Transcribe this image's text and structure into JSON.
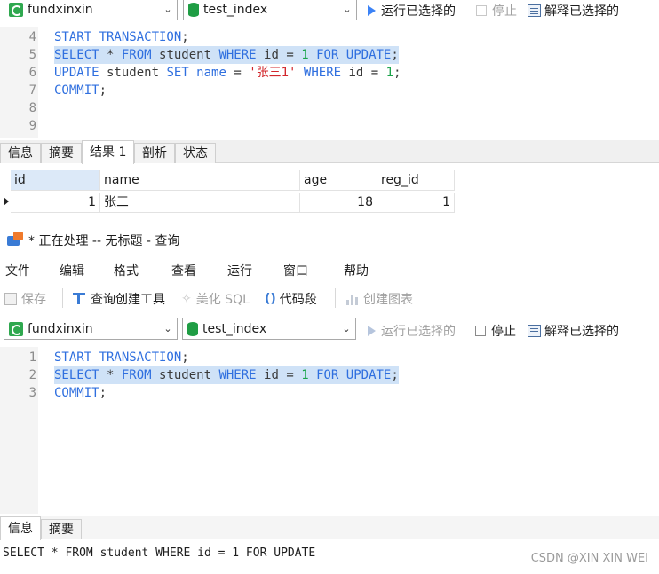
{
  "top_window": {
    "connection_select": "fundxinxin",
    "database_select": "test_index",
    "run_selected_label": "运行已选择的",
    "stop_label": "停止",
    "explain_selected_label": "解释已选择的",
    "editor_lines": [
      {
        "num": "4",
        "tokens": [
          {
            "t": "START TRANSACTION",
            "c": "kw"
          },
          {
            "t": ";",
            "c": "plain"
          }
        ],
        "highlight": false
      },
      {
        "num": "5",
        "tokens": [
          {
            "t": "SELECT",
            "c": "kw"
          },
          {
            "t": " * ",
            "c": "plain"
          },
          {
            "t": "FROM",
            "c": "kw"
          },
          {
            "t": " student ",
            "c": "plain"
          },
          {
            "t": "WHERE",
            "c": "kw"
          },
          {
            "t": " id = ",
            "c": "plain"
          },
          {
            "t": "1",
            "c": "num"
          },
          {
            "t": " ",
            "c": "plain"
          },
          {
            "t": "FOR UPDATE",
            "c": "kw"
          },
          {
            "t": ";",
            "c": "plain"
          }
        ],
        "highlight": true
      },
      {
        "num": "6",
        "tokens": [
          {
            "t": "UPDATE",
            "c": "kw"
          },
          {
            "t": " student ",
            "c": "plain"
          },
          {
            "t": "SET",
            "c": "kw"
          },
          {
            "t": " ",
            "c": "plain"
          },
          {
            "t": "name",
            "c": "kw"
          },
          {
            "t": " = ",
            "c": "plain"
          },
          {
            "t": "'张三1'",
            "c": "str"
          },
          {
            "t": " ",
            "c": "plain"
          },
          {
            "t": "WHERE",
            "c": "kw"
          },
          {
            "t": " id = ",
            "c": "plain"
          },
          {
            "t": "1",
            "c": "num"
          },
          {
            "t": ";",
            "c": "plain"
          }
        ],
        "highlight": false
      },
      {
        "num": "7",
        "tokens": [
          {
            "t": "COMMIT",
            "c": "kw"
          },
          {
            "t": ";",
            "c": "plain"
          }
        ],
        "highlight": false
      },
      {
        "num": "8",
        "tokens": [],
        "highlight": false
      },
      {
        "num": "9",
        "tokens": [],
        "highlight": false
      }
    ],
    "tabs": [
      "信息",
      "摘要",
      "结果 1",
      "剖析",
      "状态"
    ],
    "active_tab": "结果 1",
    "result_columns": [
      "id",
      "name",
      "age",
      "reg_id"
    ],
    "result_rows": [
      [
        "1",
        "张三",
        "18",
        "1"
      ]
    ]
  },
  "bottom_window": {
    "title": "* 正在处理 -- 无标题 - 查询",
    "menu": [
      "文件",
      "编辑",
      "格式",
      "查看",
      "运行",
      "窗口",
      "帮助"
    ],
    "toolbar": {
      "save": "保存",
      "query_builder": "查询创建工具",
      "beautify": "美化 SQL",
      "code_snippet": "代码段",
      "create_chart": "创建图表"
    },
    "connection_select": "fundxinxin",
    "database_select": "test_index",
    "run_selected_label": "运行已选择的",
    "stop_label": "停止",
    "explain_selected_label": "解释已选择的",
    "editor_lines": [
      {
        "num": "1",
        "tokens": [
          {
            "t": "START TRANSACTION",
            "c": "kw"
          },
          {
            "t": ";",
            "c": "plain"
          }
        ],
        "highlight": false
      },
      {
        "num": "2",
        "tokens": [
          {
            "t": "SELECT",
            "c": "kw"
          },
          {
            "t": " * ",
            "c": "plain"
          },
          {
            "t": "FROM",
            "c": "kw"
          },
          {
            "t": " student ",
            "c": "plain"
          },
          {
            "t": "WHERE",
            "c": "kw"
          },
          {
            "t": " id = ",
            "c": "plain"
          },
          {
            "t": "1",
            "c": "num"
          },
          {
            "t": " ",
            "c": "plain"
          },
          {
            "t": "FOR UPDATE",
            "c": "kw"
          },
          {
            "t": ";",
            "c": "plain"
          }
        ],
        "highlight": true
      },
      {
        "num": "3",
        "tokens": [
          {
            "t": "COMMIT",
            "c": "kw"
          },
          {
            "t": ";",
            "c": "plain"
          }
        ],
        "highlight": false
      }
    ],
    "tabs": [
      "信息",
      "摘要"
    ],
    "active_tab": "信息",
    "status_text": "SELECT * FROM student WHERE id = 1 FOR UPDATE"
  },
  "watermark": "CSDN @XIN XIN WEI",
  "colors": {
    "keyword": "#2f6fdf",
    "number": "#1aa34a",
    "string": "#d2262b",
    "selection": "#cfe2f7"
  },
  "icons": [
    "connection-icon",
    "database-icon",
    "play-icon",
    "checkbox-icon",
    "explain-icon",
    "save-icon",
    "query-builder-icon",
    "beautify-icon",
    "code-snippet-icon",
    "chart-icon",
    "app-window-icon",
    "chevron-down-icon",
    "row-pointer-icon"
  ]
}
